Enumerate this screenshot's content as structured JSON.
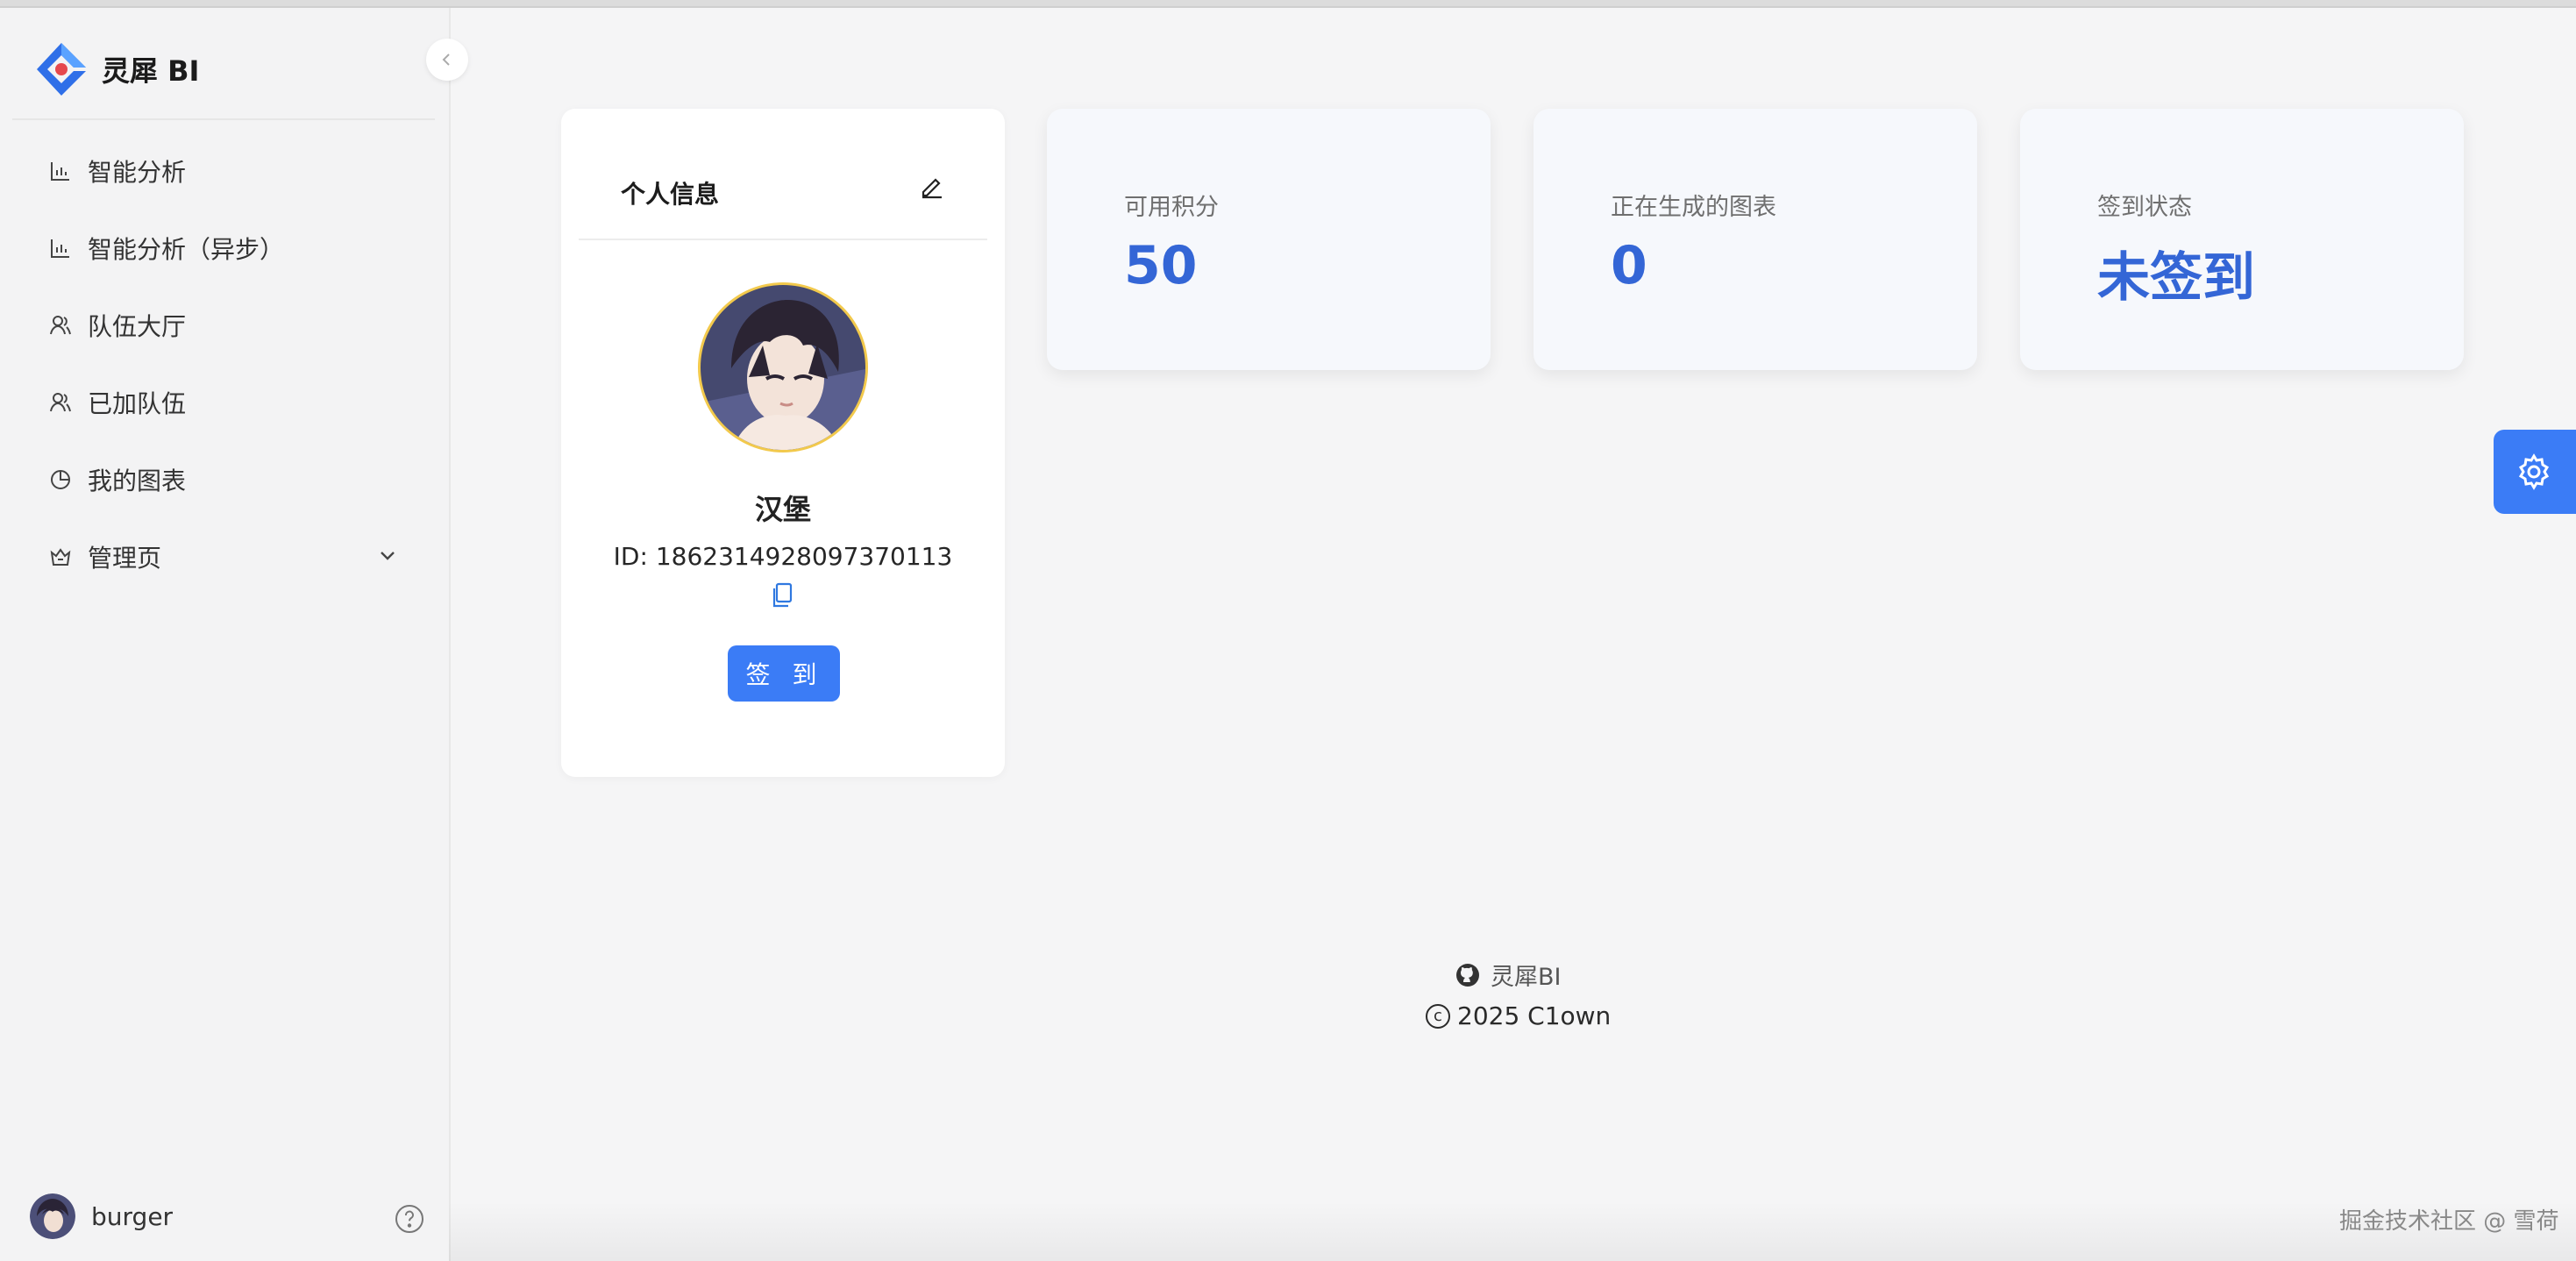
{
  "app": {
    "name": "灵犀 BI"
  },
  "sidebar": {
    "items": [
      {
        "label": "智能分析",
        "icon": "bar-chart-icon"
      },
      {
        "label": "智能分析（异步）",
        "icon": "bar-chart-icon"
      },
      {
        "label": "队伍大厅",
        "icon": "team-icon"
      },
      {
        "label": "已加队伍",
        "icon": "team-icon"
      },
      {
        "label": "我的图表",
        "icon": "pie-chart-icon"
      },
      {
        "label": "管理页",
        "icon": "crown-icon"
      }
    ],
    "user": {
      "name": "burger"
    }
  },
  "profile": {
    "title": "个人信息",
    "name": "汉堡",
    "id_text": "ID: 1862314928097370113",
    "signin_label": "签 到"
  },
  "stats": [
    {
      "label": "可用积分",
      "value": "50"
    },
    {
      "label": "正在生成的图表",
      "value": "0"
    },
    {
      "label": "签到状态",
      "value": "未签到"
    }
  ],
  "footer": {
    "link": "灵犀BI",
    "copyright": "2025 C1own"
  },
  "watermark": "掘金技术社区 @ 雪荷",
  "colors": {
    "primary": "#3b7cf6",
    "stat_value": "#3466d6",
    "avatar_ring": "#f2c94c"
  }
}
